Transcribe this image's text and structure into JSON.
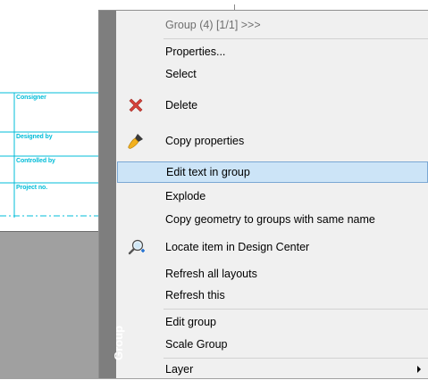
{
  "drawing": {
    "title_block": [
      {
        "label": "Consigner"
      },
      {
        "label": "Designed by"
      },
      {
        "label": "Controlled by"
      },
      {
        "label": "Project no."
      }
    ]
  },
  "menu": {
    "side_title": "Group",
    "header": "Group (4) [1/1] >>>",
    "items": {
      "properties": "Properties...",
      "select": "Select",
      "delete": "Delete",
      "copy_properties": "Copy properties",
      "edit_text_in_group": "Edit text in group",
      "explode": "Explode",
      "copy_geometry": "Copy geometry to groups with same name",
      "locate_item": "Locate item in Design Center",
      "refresh_all_layouts": "Refresh all layouts",
      "refresh_this": "Refresh this",
      "edit_group": "Edit group",
      "scale_group": "Scale Group",
      "layer": "Layer"
    },
    "highlighted_item": "edit_text_in_group",
    "colors": {
      "highlight_bg": "#cce4f7",
      "highlight_border": "#7aa7d4",
      "side_strip": "#7e7e7e",
      "cad_cyan": "#00bcd8"
    },
    "icons": {
      "delete": "red-x-icon",
      "copy_properties": "paintbrush-icon",
      "locate_item": "magnifier-plus-icon",
      "layer": "submenu-arrow-icon"
    }
  }
}
